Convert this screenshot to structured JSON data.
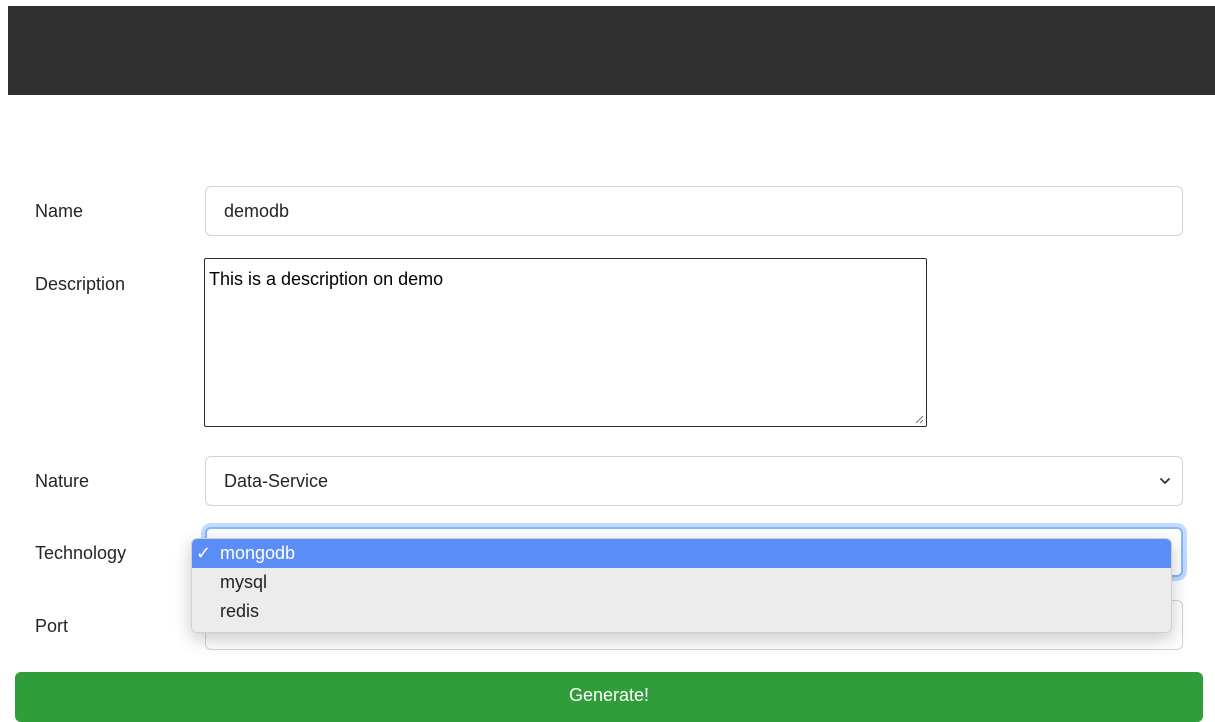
{
  "form": {
    "name": {
      "label": "Name",
      "value": "demodb"
    },
    "description": {
      "label": "Description",
      "value": "This is a description on demo"
    },
    "nature": {
      "label": "Nature",
      "value": "Data-Service"
    },
    "technology": {
      "label": "Technology",
      "selected": "mongodb",
      "options": [
        "mongodb",
        "mysql",
        "redis"
      ],
      "check_glyph": "✓"
    },
    "port": {
      "label": "Port",
      "value": ""
    },
    "submit_label": "Generate!"
  },
  "colors": {
    "topbar": "#2f2f2f",
    "button": "#2e9d3a",
    "selected_option": "#5b8df6",
    "focus_ring": "#86b7fe"
  },
  "icons": {
    "select_arrow": "chevron-down-icon",
    "textarea_grip": "resize-grip-icon",
    "selected_marker": "checkmark-icon"
  }
}
